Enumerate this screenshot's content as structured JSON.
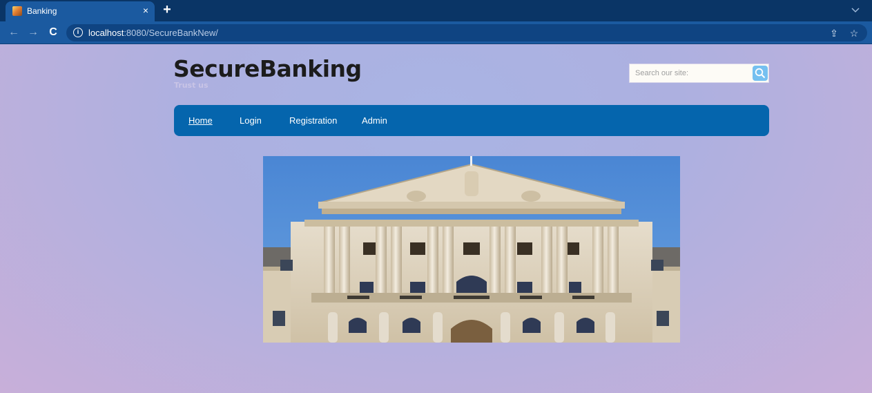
{
  "browser": {
    "tab_title": "Banking",
    "tab_close": "×",
    "new_tab": "+",
    "url_host": "localhost",
    "url_rest": ":8080/SecureBankNew/",
    "back": "←",
    "forward": "→",
    "reload": "C",
    "share": "⇪",
    "bookmark": "☆"
  },
  "site": {
    "title": "SecureBanking",
    "tagline": "Trust us"
  },
  "search": {
    "placeholder": "Search our site:"
  },
  "nav": {
    "items": [
      {
        "label": "Home"
      },
      {
        "label": "Login"
      },
      {
        "label": "Registration"
      },
      {
        "label": "Admin"
      }
    ]
  }
}
